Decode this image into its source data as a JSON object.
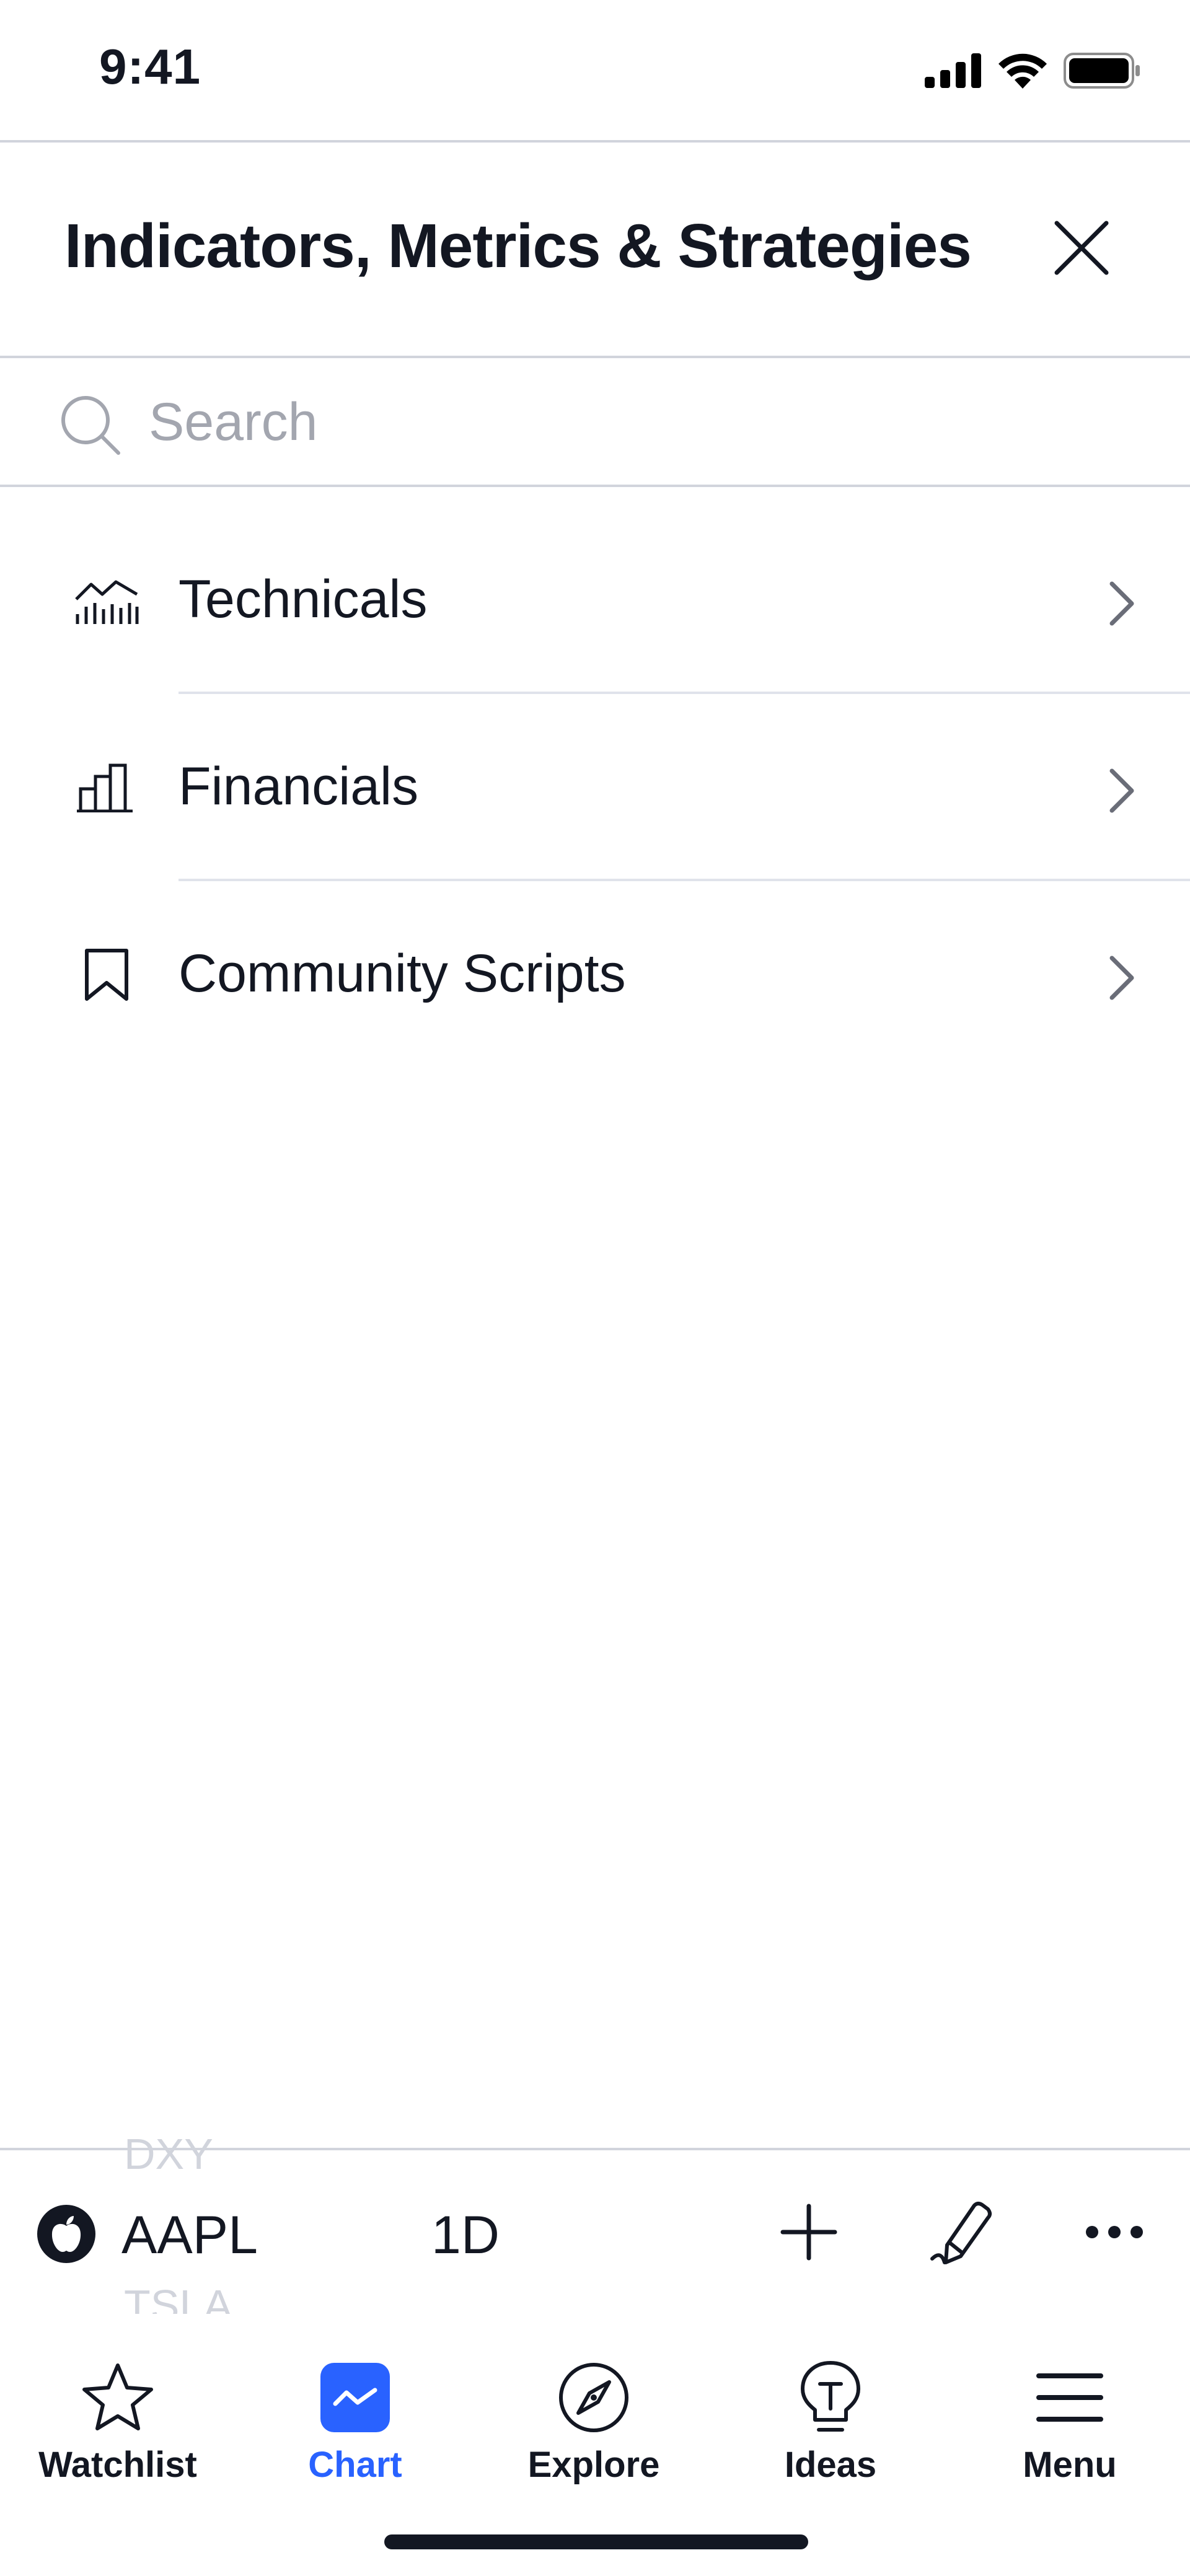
{
  "status_bar": {
    "time": "9:41"
  },
  "panel": {
    "title": "Indicators, Metrics & Strategies",
    "search_placeholder": "Search",
    "search_value": ""
  },
  "menu_items": [
    {
      "label": "Technicals",
      "icon": "technicals-icon"
    },
    {
      "label": "Financials",
      "icon": "financials-icon"
    },
    {
      "label": "Community Scripts",
      "icon": "bookmark-icon"
    }
  ],
  "chart_toolbar": {
    "ticker": "AAPL",
    "ticker_logo": "apple-logo-icon",
    "interval": "1D",
    "prev_ticker": "DXY",
    "next_ticker": "TSLA"
  },
  "tab_bar": {
    "active": "Chart",
    "tabs": [
      {
        "label": "Watchlist",
        "icon": "star-icon"
      },
      {
        "label": "Chart",
        "icon": "chart-icon"
      },
      {
        "label": "Explore",
        "icon": "compass-icon"
      },
      {
        "label": "Ideas",
        "icon": "lightbulb-icon"
      },
      {
        "label": "Menu",
        "icon": "hamburger-icon"
      }
    ]
  },
  "colors": {
    "accent": "#2962ff",
    "text": "#131722",
    "divider": "#d1d4dc",
    "placeholder": "#a3a6af"
  }
}
